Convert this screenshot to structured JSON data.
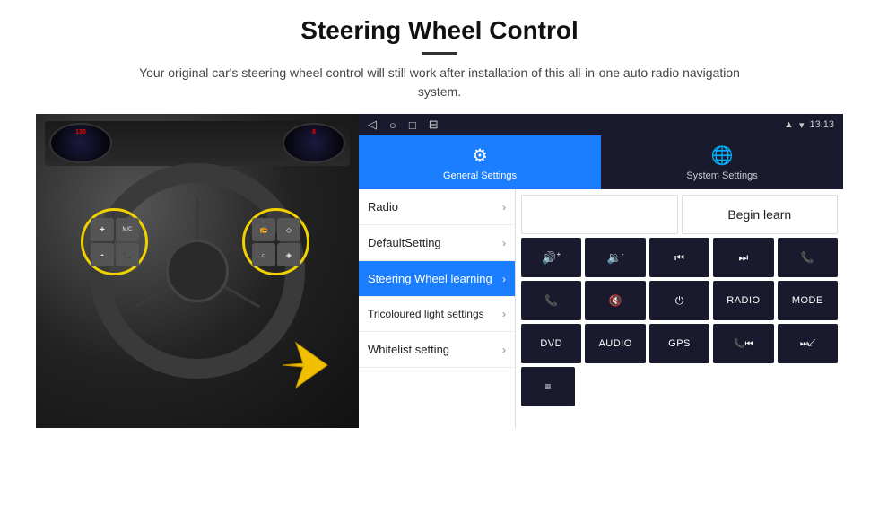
{
  "header": {
    "title": "Steering Wheel Control",
    "subtitle": "Your original car's steering wheel control will still work after installation of this all-in-one auto radio navigation system."
  },
  "statusbar": {
    "time": "13:13",
    "nav_icons": [
      "◁",
      "○",
      "□",
      "⊟"
    ]
  },
  "tabs": [
    {
      "id": "general",
      "label": "General Settings",
      "icon": "⚙",
      "active": true
    },
    {
      "id": "system",
      "label": "System Settings",
      "icon": "🌐",
      "active": false
    }
  ],
  "menu": {
    "items": [
      {
        "id": "radio",
        "label": "Radio",
        "active": false
      },
      {
        "id": "default",
        "label": "DefaultSetting",
        "active": false
      },
      {
        "id": "steering",
        "label": "Steering Wheel learning",
        "active": true
      },
      {
        "id": "tricoloured",
        "label": "Tricoloured light settings",
        "active": false
      },
      {
        "id": "whitelist",
        "label": "Whitelist setting",
        "active": false
      }
    ]
  },
  "controls": {
    "begin_learn_label": "Begin learn",
    "row1": [
      {
        "id": "vol_up",
        "icon": "🔊+",
        "label": "vol-up"
      },
      {
        "id": "vol_down",
        "icon": "🔉-",
        "label": "vol-down"
      },
      {
        "id": "prev_track",
        "icon": "⏮",
        "label": "prev-track"
      },
      {
        "id": "next_track",
        "icon": "⏭",
        "label": "next-track"
      },
      {
        "id": "phone",
        "icon": "📞",
        "label": "phone"
      }
    ],
    "row2": [
      {
        "id": "answer",
        "icon": "📞",
        "label": "answer"
      },
      {
        "id": "mute",
        "icon": "🔇",
        "label": "mute"
      },
      {
        "id": "power",
        "icon": "⏻",
        "label": "power"
      },
      {
        "id": "radio_btn",
        "label": "RADIO",
        "text": true
      },
      {
        "id": "mode_btn",
        "label": "MODE",
        "text": true
      }
    ],
    "row3": [
      {
        "id": "dvd",
        "label": "DVD",
        "text": true
      },
      {
        "id": "audio",
        "label": "AUDIO",
        "text": true
      },
      {
        "id": "gps",
        "label": "GPS",
        "text": true
      },
      {
        "id": "phone2",
        "icon": "📞⏮",
        "label": "phone-prev"
      },
      {
        "id": "next2",
        "icon": "⏭↙",
        "label": "next-skip"
      }
    ],
    "row4": [
      {
        "id": "list_icon",
        "icon": "≡",
        "label": "list-icon"
      }
    ]
  }
}
